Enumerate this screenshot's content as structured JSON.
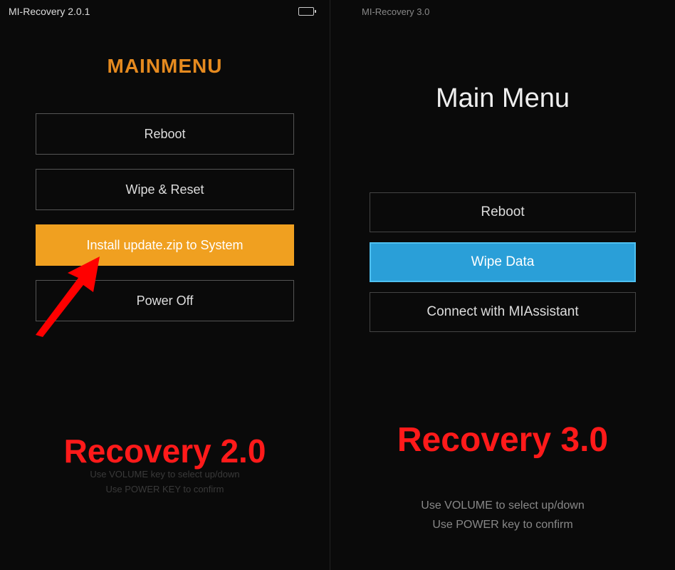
{
  "left": {
    "statusbar_title": "MI-Recovery 2.0.1",
    "mainmenu_title": "MAINMENU",
    "buttons": {
      "reboot": "Reboot",
      "wipe_reset": "Wipe & Reset",
      "install": "Install update.zip to System",
      "power_off": "Power Off"
    },
    "recovery_label": "Recovery 2.0",
    "hint_line1": "Use VOLUME key to select up/down",
    "hint_line2": "Use POWER KEY to confirm"
  },
  "right": {
    "statusbar_title": "MI-Recovery 3.0",
    "mainmenu_title": "Main Menu",
    "buttons": {
      "reboot": "Reboot",
      "wipe_data": "Wipe Data",
      "miassistant": "Connect with MIAssistant"
    },
    "recovery_label": "Recovery 3.0",
    "hint_line1": "Use VOLUME to select up/down",
    "hint_line2": "Use POWER key to confirm"
  }
}
